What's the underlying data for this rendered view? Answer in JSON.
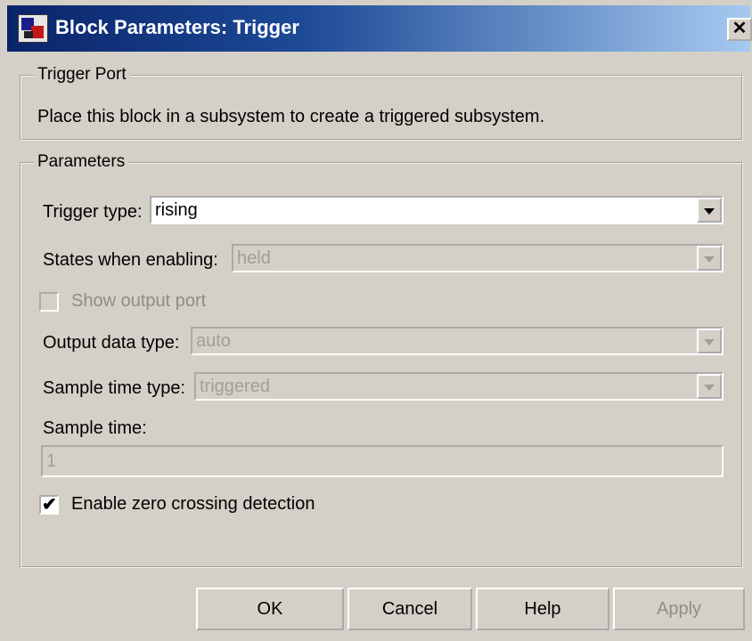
{
  "window": {
    "title": "Block Parameters: Trigger",
    "close_glyph": "✕"
  },
  "trigger_port": {
    "legend": "Trigger Port",
    "description": "Place this block in a subsystem to create a triggered subsystem."
  },
  "parameters": {
    "legend": "Parameters",
    "trigger_type": {
      "label": "Trigger type:",
      "value": "rising"
    },
    "states_when_enabling": {
      "label": "States when enabling:",
      "value": "held"
    },
    "show_output_port": {
      "label": "Show output port",
      "checked": false
    },
    "output_data_type": {
      "label": "Output data type:",
      "value": "auto"
    },
    "sample_time_type": {
      "label": "Sample time type:",
      "value": "triggered"
    },
    "sample_time": {
      "label": "Sample time:",
      "value": "1"
    },
    "enable_zero_crossing": {
      "label": "Enable zero crossing detection",
      "checked": true,
      "check_glyph": "✔"
    }
  },
  "buttons": {
    "ok": "OK",
    "cancel": "Cancel",
    "help": "Help",
    "apply": "Apply"
  },
  "icons": {
    "app": "simulink-block-icon",
    "close": "close-icon",
    "dropdown": "chevron-down-icon"
  }
}
